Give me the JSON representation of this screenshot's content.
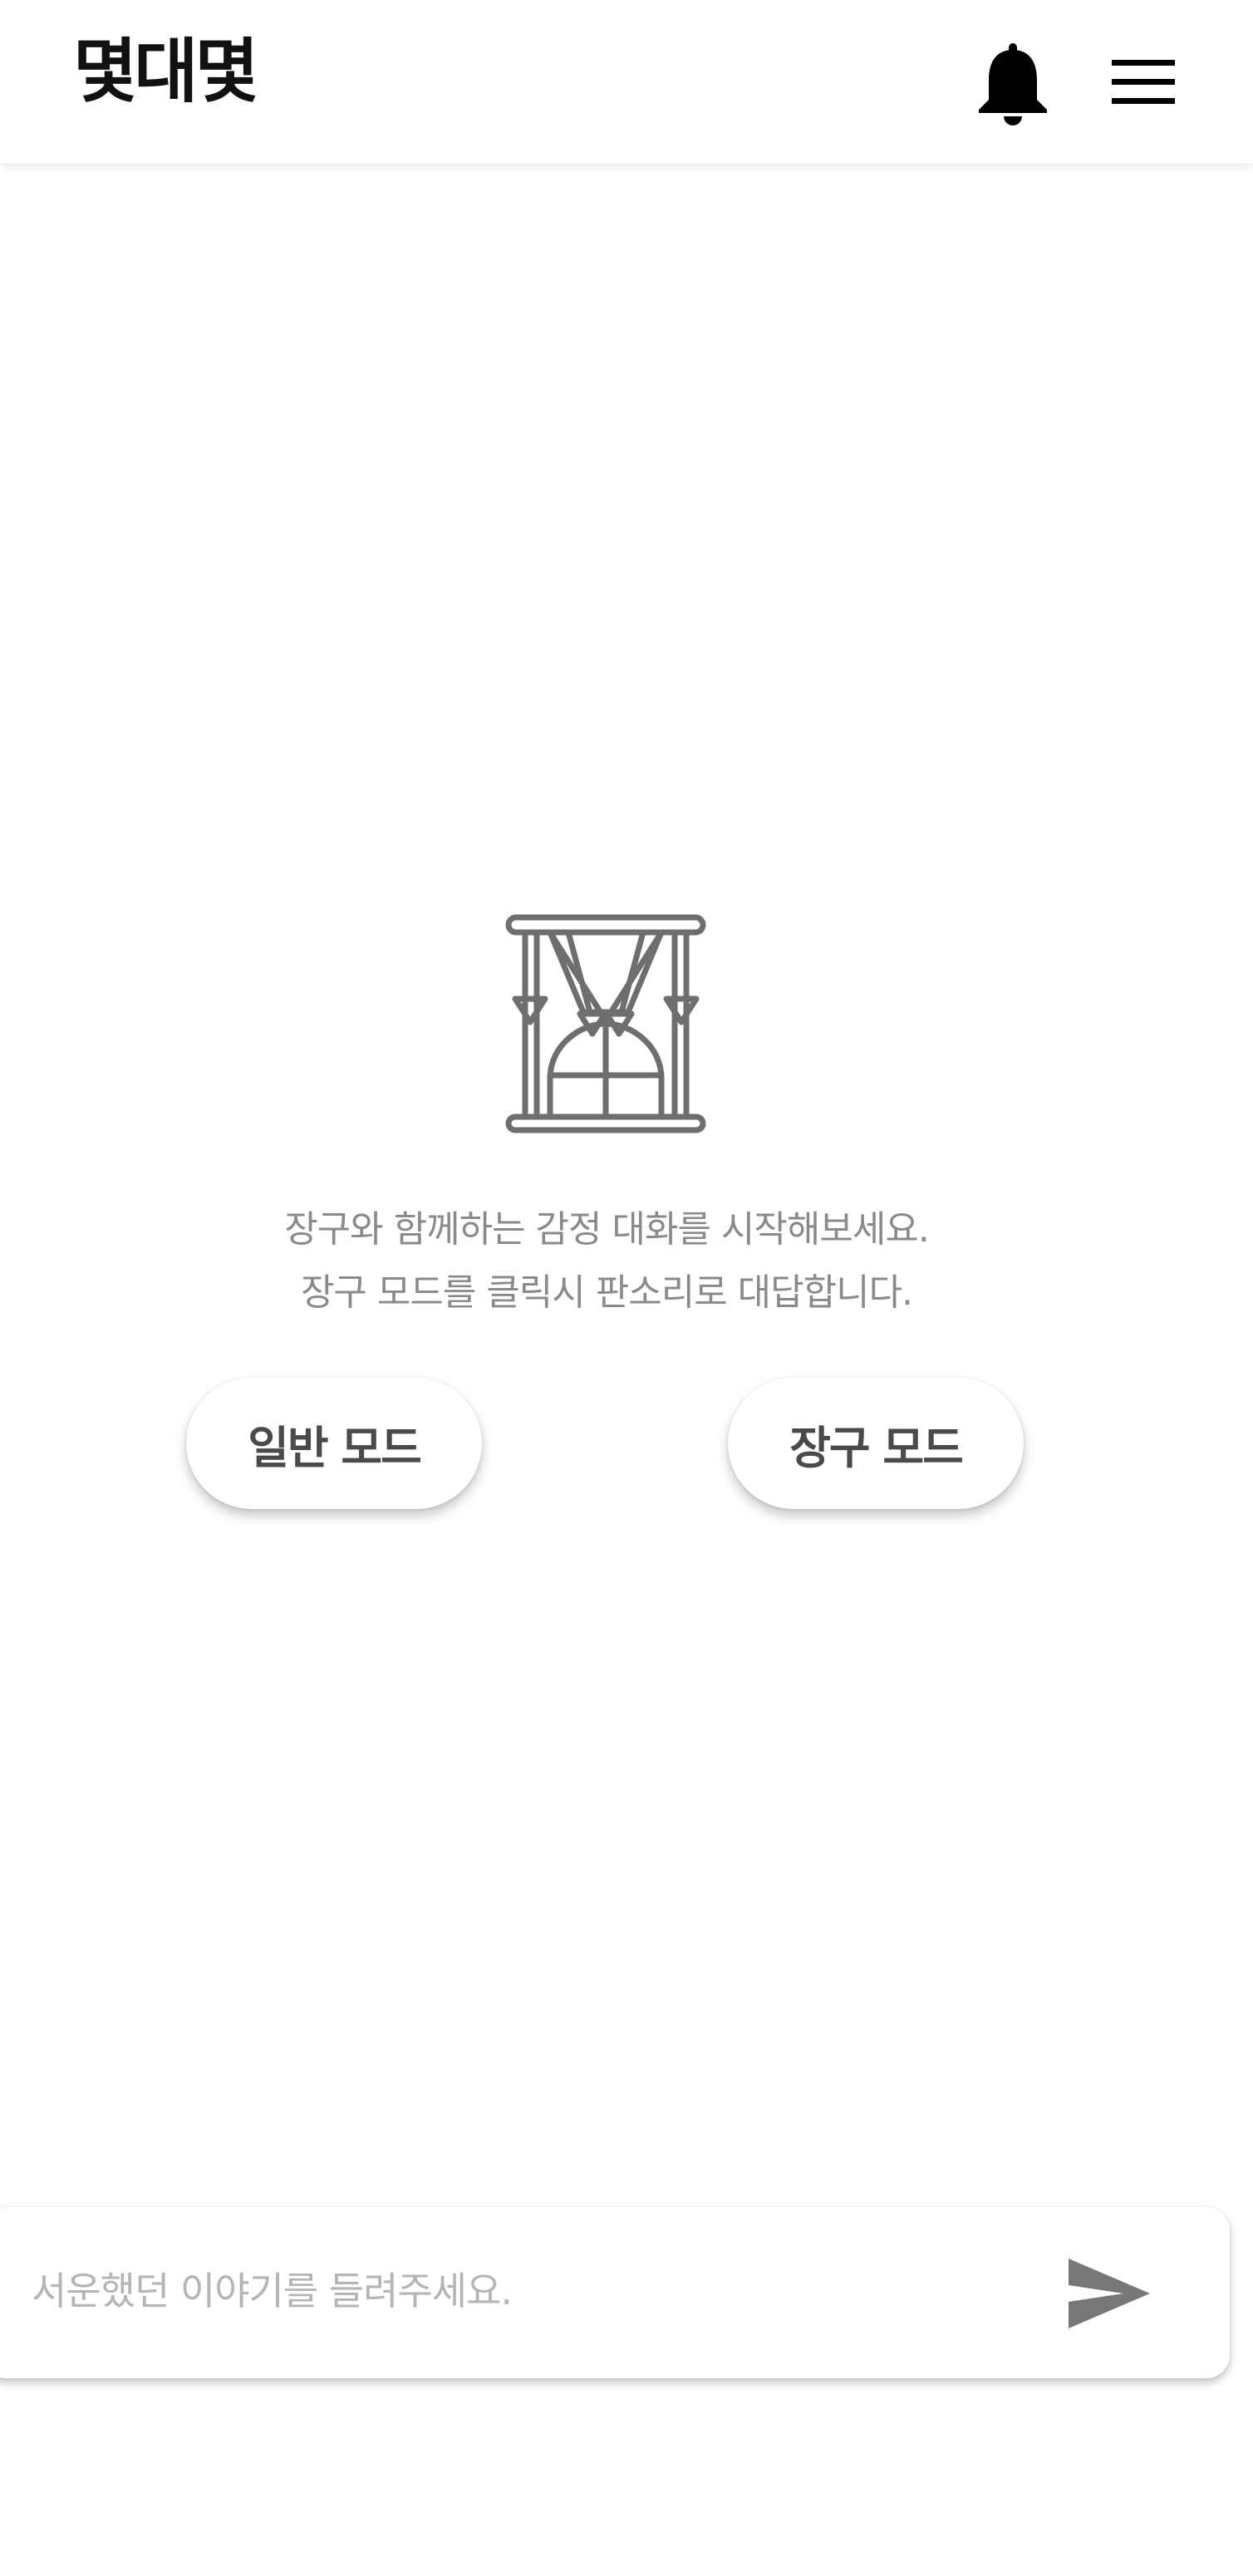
{
  "header": {
    "app_title": "몇대몇",
    "icons": {
      "notifications": "bell-icon",
      "menu": "hamburger-menu-icon"
    }
  },
  "main": {
    "illustration": "janggu-drum-icon",
    "intro_lines": [
      "장구와 함께하는 감정 대화를 시작해보세요.",
      "장구 모드를 클릭시 판소리로 대답합니다."
    ],
    "buttons": {
      "normal_mode": "일반 모드",
      "janggu_mode": "장구 모드"
    }
  },
  "composer": {
    "value": "",
    "placeholder": "서운했던 이야기를 들려주세요.",
    "send_icon": "send-icon"
  },
  "colors": {
    "text_primary": "#111111",
    "text_muted": "#8a8a8a",
    "placeholder": "#b5b5b5",
    "icon_gray": "#777777",
    "background": "#ffffff"
  }
}
